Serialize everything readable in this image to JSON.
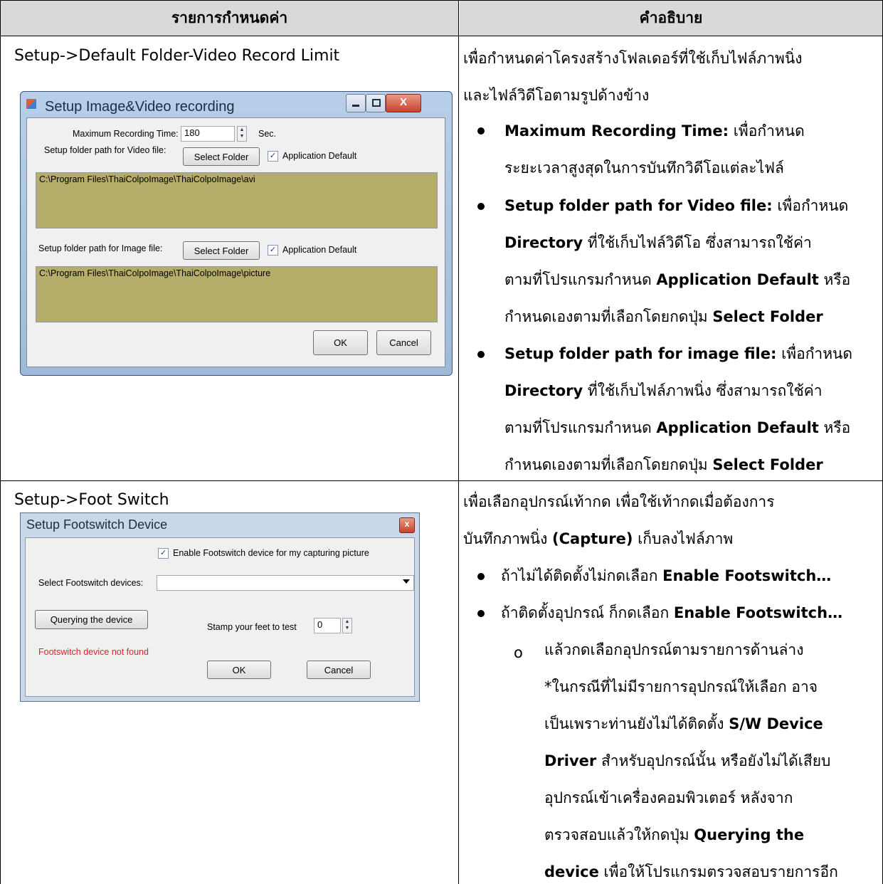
{
  "table": {
    "header_left": "รายการกำหนดค่า",
    "header_right": "คำอธิบาย"
  },
  "row1": {
    "title": "Setup->Default Folder-Video Record Limit",
    "intro1": "เพื่อกำหนดค่าโครงสร้างโฟลเดอร์ที่ใช้เก็บไฟล์ภาพนิ่ง",
    "intro2": "และไฟล์วิดีโอตามรูปด้างข้าง",
    "b1_label": "Maximum Recording Time:",
    "b1_text1": " เพื่อกำหนด",
    "b1_text2": "ระยะเวลาสูงสุดในการบันทึกวิดีโอแต่ละไฟล์",
    "b2_label": "Setup folder path for Video file:",
    "b2_text1": " เพื่อกำหนด",
    "b2_dir": "Directory",
    "b2_text2": " ที่ใช้เก็บไฟล์วิดีโอ ซึ่งสามารถใช้ค่า",
    "b2_text3a": "ตามที่โปรแกรมกำหนด ",
    "b2_appdef": "Application Default",
    "b2_text3b": " หรือ",
    "b2_text4a": "กำหนดเองตามที่เลือกโดยกดปุ่ม ",
    "b2_sel": "Select Folder",
    "b3_label": "Setup folder path for image file:",
    "b3_text1": " เพื่อกำหนด",
    "b3_dir": "Directory",
    "b3_text2": " ที่ใช้เก็บไฟล์ภาพนิ่ง ซึ่งสามารถใช้ค่า",
    "b3_text3a": "ตามที่โปรแกรมกำหนด ",
    "b3_appdef": "Application Default",
    "b3_text3b": " หรือ",
    "b3_text4a": "กำหนดเองตามที่เลือกโดยกดปุ่ม ",
    "b3_sel": "Select Folder"
  },
  "dialog1": {
    "title": "Setup Image&Video recording",
    "max_time_label": "Maximum Recording Time:",
    "max_time_value": "180",
    "sec": "Sec.",
    "video_path_label": "Setup folder path for Video file:",
    "select_folder": "Select Folder",
    "app_default": "Application Default",
    "video_path": "C:\\Program Files\\ThaiColpoImage\\ThaiColpoImage\\avi",
    "image_path_label": "Setup folder path for Image file:",
    "image_path": "C:\\Program Files\\ThaiColpoImage\\ThaiColpoImage\\picture",
    "ok": "OK",
    "cancel": "Cancel"
  },
  "row2": {
    "title": "Setup->Foot Switch",
    "intro1": "เพื่อเลือกอุปกรณ์เท้ากด เพื่อใช้เท้ากดเมื่อต้องการ",
    "intro2a": "บันทึกภาพนิ่ง ",
    "intro2b": "(Capture)",
    "intro2c": " เก็บลงไฟล์ภาพ",
    "b1a": "ถ้าไม่ได้ติดตั้งไม่กดเลือก ",
    "b1b": "Enable Footswitch…",
    "b2a": "ถ้าติดตั้งอุปกรณ์ ก็กดเลือก ",
    "b2b": "Enable Footswitch…",
    "sub_marker": "o",
    "s1": "แล้วกดเลือกอุปกรณ์ตามรายการด้านล่าง",
    "s2": "*ในกรณีที่ไม่มีรายการอุปกรณ์ให้เลือก อาจ",
    "s3a": "เป็นเพราะท่านยังไม่ได้ติดตั้ง ",
    "s3b": "S/W Device",
    "s4a": "Driver",
    "s4b": " สำหรับอุปกรณ์นั้น หรือยังไม่ได้เสียบ",
    "s5": "อุปกรณ์เข้าเครื่องคอมพิวเตอร์ หลังจาก",
    "s6a": "ตรวจสอบแล้วให้กดปุ่ม ",
    "s6b": "Querying the",
    "s7a": "device",
    "s7b": " เพื่อให้โปรแกรมตรวจสอบรายการอีก"
  },
  "dialog2": {
    "title": "Setup Footswitch Device",
    "enable": "Enable Footswitch device for my capturing picture",
    "select_label": "Select Footswitch devices:",
    "query": "Querying the device",
    "stamp": "Stamp your feet to test",
    "stamp_value": "0",
    "not_found": "Footswitch device not found",
    "ok": "OK",
    "cancel": "Cancel"
  }
}
